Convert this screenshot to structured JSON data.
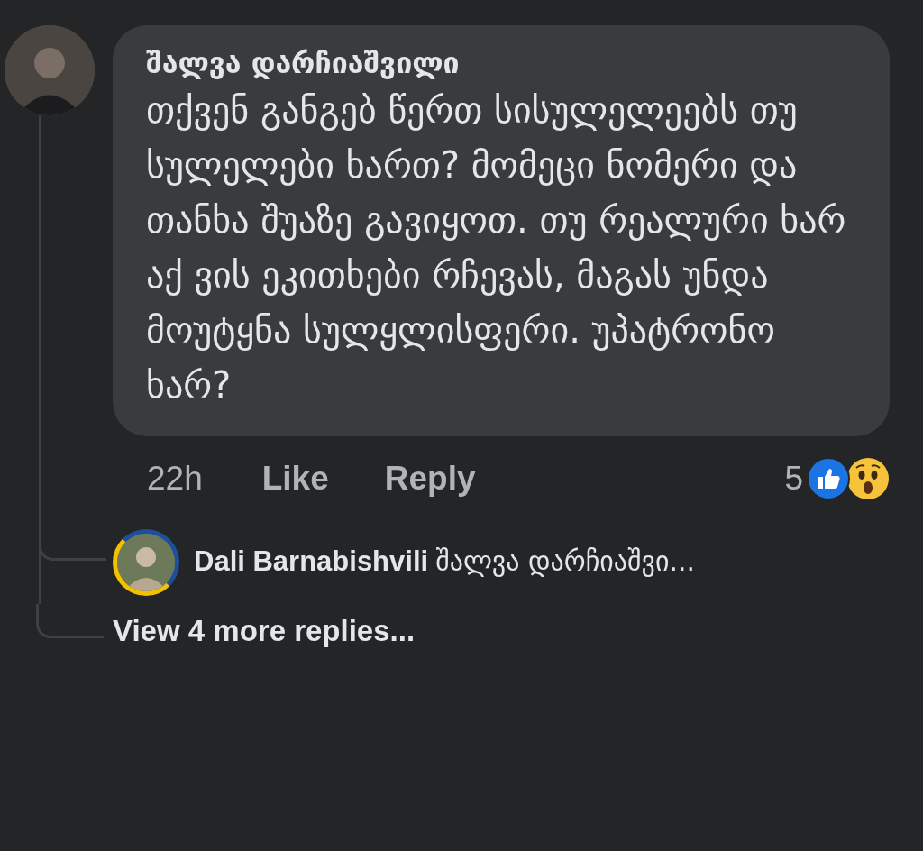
{
  "comment": {
    "author": "შალვა დარჩიაშვილი",
    "text": "თქვენ განგებ წერთ სისულელეებს თუ სულელები ხართ? მომეცი ნომერი და თანხა შუაზე გავიყოთ. თუ რეალური ხარ აქ ვის ეკითხები რჩევას, მაგას უნდა მოუტყნა სულყლისფერი. უპატრონო ხარ?",
    "time": "22h",
    "actions": [
      "Like",
      "Reply"
    ],
    "reaction_count": "5",
    "reactions": [
      {
        "kind": "like"
      },
      {
        "kind": "wow"
      }
    ]
  },
  "reply": {
    "author": "Dali Barnabishvili",
    "text": "შალვა დარჩიაშვი..."
  },
  "view_more": "View 4 more replies..."
}
